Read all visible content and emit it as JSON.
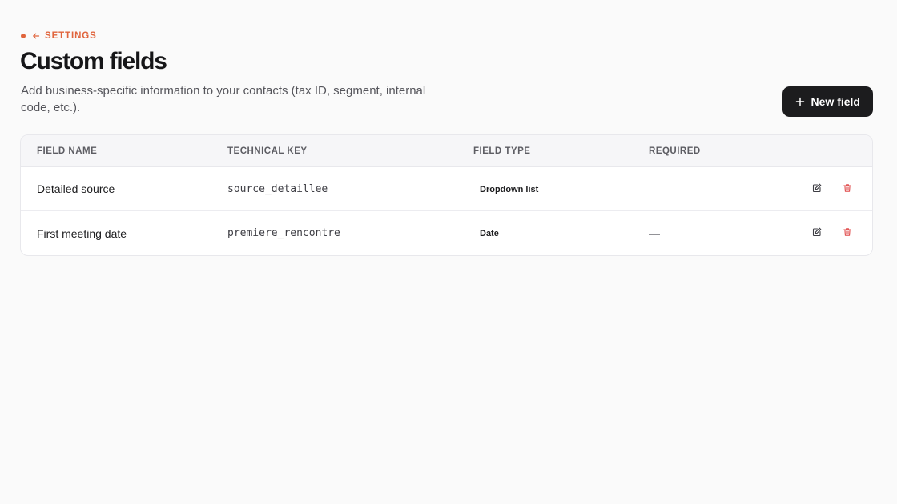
{
  "breadcrumb": {
    "label": "SETTINGS"
  },
  "header": {
    "title": "Custom fields",
    "subtitle": "Add business-specific information to your contacts (tax ID, segment, internal code, etc.)."
  },
  "actions": {
    "new_field_label": "New field"
  },
  "table": {
    "columns": [
      "FIELD NAME",
      "TECHNICAL KEY",
      "FIELD TYPE",
      "REQUIRED"
    ],
    "rows": [
      {
        "name": "Detailed source",
        "key": "source_detaillee",
        "type": "Dropdown list",
        "required": "—"
      },
      {
        "name": "First meeting date",
        "key": "premiere_rencontre",
        "type": "Date",
        "required": "—"
      }
    ]
  },
  "icons": {
    "back": "arrow-left-icon",
    "add": "plus-icon",
    "edit": "edit-icon",
    "delete": "trash-icon"
  },
  "colors": {
    "accent": "#e0643c",
    "primary_button": "#1c1c1e",
    "delete": "#e04a4a"
  }
}
